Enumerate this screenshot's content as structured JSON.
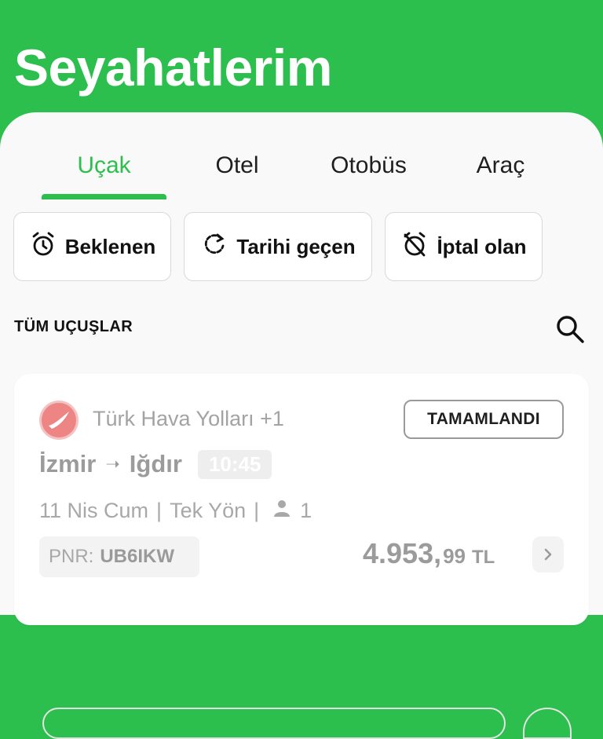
{
  "header": {
    "title": "Seyahatlerim"
  },
  "tabs": [
    {
      "label": "Uçak",
      "active": true
    },
    {
      "label": "Otel",
      "active": false
    },
    {
      "label": "Otobüs",
      "active": false
    },
    {
      "label": "Araç",
      "active": false
    }
  ],
  "filters": [
    {
      "label": "Beklenen",
      "icon": "alarm-clock-icon"
    },
    {
      "label": "Tarihi geçen",
      "icon": "refresh-icon"
    },
    {
      "label": "İptal olan",
      "icon": "alarm-off-icon"
    }
  ],
  "section": {
    "title": "TÜM UÇUŞLAR",
    "search_icon": "search-icon"
  },
  "trip": {
    "airline": "Türk Hava Yolları +1",
    "status": "TAMAMLANDI",
    "origin": "İzmir",
    "destination": "Iğdır",
    "arrow": "➝",
    "time": "10:45",
    "date": "11 Nis Cum",
    "separator": "|",
    "trip_type": "Tek Yön",
    "passengers": "1",
    "pnr_label": "PNR:",
    "pnr_code": "UB6IKW",
    "price_main": "4.953,",
    "price_decimal": "99",
    "currency": "TL"
  },
  "colors": {
    "brand": "#2dbf4e",
    "background": "#f9f9f9"
  }
}
